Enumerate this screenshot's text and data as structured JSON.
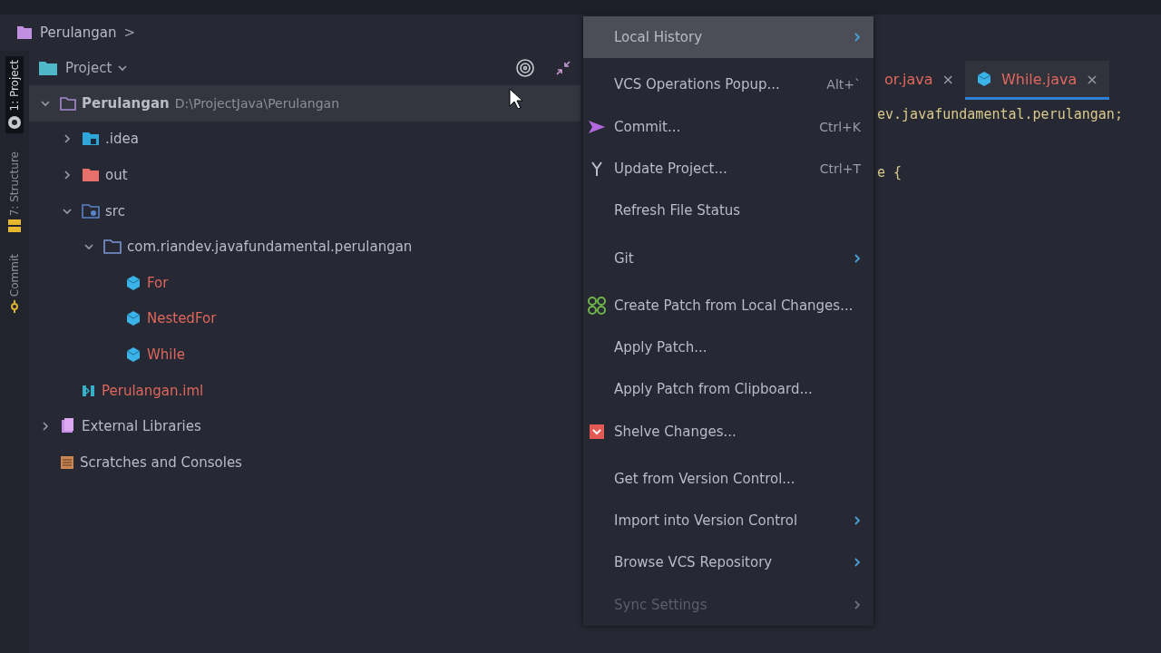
{
  "breadcrumb": {
    "label": "Perulangan",
    "separator": ">"
  },
  "project_panel": {
    "title": "Project",
    "tree": [
      {
        "label": "Perulangan",
        "path": "D:\\ProjectJava\\Perulangan",
        "kind": "module",
        "unversioned": false,
        "selected": true,
        "expanded": true,
        "children": [
          {
            "label": ".idea",
            "kind": "idea",
            "unversioned": false,
            "selected": false,
            "expanded": false
          },
          {
            "label": "out",
            "kind": "excluded",
            "unversioned": false,
            "selected": false,
            "expanded": false
          },
          {
            "label": "src",
            "kind": "source",
            "unversioned": false,
            "selected": false,
            "expanded": true,
            "children": [
              {
                "label": "com.riandev.javafundamental.perulangan",
                "kind": "package",
                "unversioned": false,
                "selected": false,
                "expanded": true,
                "children": [
                  {
                    "label": "For",
                    "kind": "class",
                    "unversioned": true,
                    "selected": false
                  },
                  {
                    "label": "NestedFor",
                    "kind": "class",
                    "unversioned": true,
                    "selected": false
                  },
                  {
                    "label": "While",
                    "kind": "class",
                    "unversioned": true,
                    "selected": false
                  }
                ]
              }
            ]
          },
          {
            "label": "Perulangan.iml",
            "kind": "iml",
            "unversioned": true,
            "selected": false
          }
        ]
      },
      {
        "label": "External Libraries",
        "kind": "library",
        "unversioned": false,
        "selected": false,
        "expanded": false
      },
      {
        "label": "Scratches and Consoles",
        "kind": "scratches",
        "unversioned": false,
        "selected": false
      }
    ]
  },
  "tool_strip": [
    {
      "label": "1: Project",
      "kind": "project",
      "selected": true
    },
    {
      "label": "7: Structure",
      "kind": "structure",
      "selected": false
    },
    {
      "label": "Commit",
      "kind": "commit",
      "selected": false
    }
  ],
  "editor": {
    "tabs": [
      {
        "label": "or.java",
        "selected": false,
        "unversioned": true
      },
      {
        "label": "While.java",
        "selected": true,
        "unversioned": true
      }
    ],
    "close": "×",
    "lines": [
      "ev.javafundamental.perulangan;",
      "e {"
    ]
  },
  "menu": {
    "groups": [
      [
        {
          "label": "Local History",
          "submenu": true,
          "selected": true,
          "disabled": false
        }
      ],
      [
        {
          "label": "VCS Operations Popup...",
          "shortcut": "Alt+`",
          "selected": false,
          "disabled": false
        },
        {
          "label": "Commit...",
          "shortcut": "Ctrl+K",
          "kind": "commit",
          "selected": false,
          "disabled": false
        },
        {
          "label": "Update Project...",
          "shortcut": "Ctrl+T",
          "kind": "update",
          "selected": false,
          "disabled": false
        },
        {
          "label": "Refresh File Status",
          "selected": false,
          "disabled": false
        }
      ],
      [
        {
          "label": "Git",
          "submenu": true,
          "selected": false,
          "disabled": false
        }
      ],
      [
        {
          "label": "Create Patch from Local Changes...",
          "kind": "patch",
          "selected": false,
          "disabled": false
        },
        {
          "label": "Apply Patch...",
          "selected": false,
          "disabled": false
        },
        {
          "label": "Apply Patch from Clipboard...",
          "selected": false,
          "disabled": false
        },
        {
          "label": "Shelve Changes...",
          "kind": "shelve",
          "selected": false,
          "disabled": false
        }
      ],
      [
        {
          "label": "Get from Version Control...",
          "selected": false,
          "disabled": false
        },
        {
          "label": "Import into Version Control",
          "submenu": true,
          "selected": false,
          "disabled": false
        },
        {
          "label": "Browse VCS Repository",
          "submenu": true,
          "selected": false,
          "disabled": false
        },
        {
          "label": "Sync Settings",
          "submenu": true,
          "selected": false,
          "disabled": true
        }
      ]
    ]
  }
}
